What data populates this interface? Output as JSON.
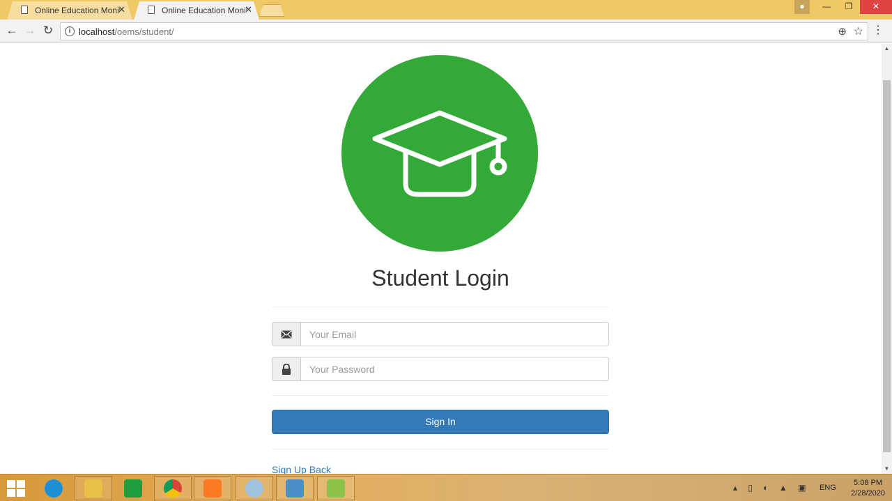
{
  "browser": {
    "tabs": [
      {
        "title": "Online Education Monito",
        "active": false
      },
      {
        "title": "Online Education Monito",
        "active": true
      }
    ],
    "url_host": "localhost",
    "url_path": "/oems/student/"
  },
  "page": {
    "heading": "Student Login",
    "email_placeholder": "Your Email",
    "password_placeholder": "Your Password",
    "signin_label": "Sign In",
    "signup_label": "Sign Up",
    "back_label": "Back",
    "brand_color": "#33aa38",
    "button_color": "#337ab7"
  },
  "icons": {
    "logo": "graduation-cap-icon",
    "email": "envelope-icon",
    "password": "lock-icon"
  },
  "taskbar": {
    "apps": [
      "internet-explorer-icon",
      "file-explorer-icon",
      "store-icon",
      "chrome-icon",
      "xampp-icon",
      "paint-icon",
      "photo-viewer-icon",
      "notepad-icon"
    ],
    "language": "ENG",
    "time": "5:08 PM",
    "date": "2/28/2020"
  }
}
